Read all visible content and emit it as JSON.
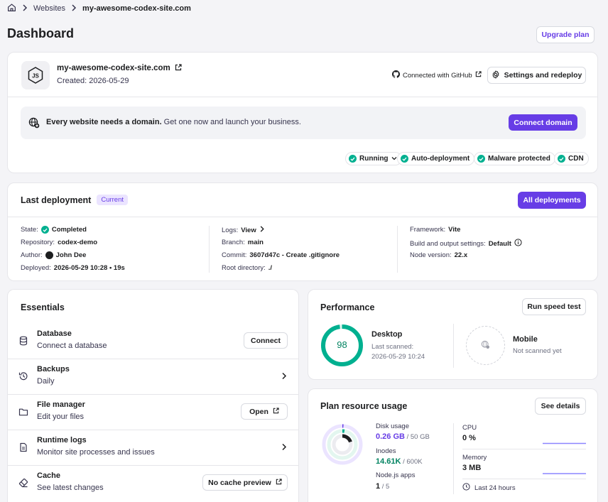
{
  "breadcrumb": {
    "home_icon": "home-icon",
    "item1": "Websites",
    "item2": "my-awesome-codex-site.com"
  },
  "page_title": "Dashboard",
  "upgrade_label": "Upgrade plan",
  "site": {
    "name": "my-awesome-codex-site.com",
    "created": "Created: 2026-05-29",
    "github": "Connected with GitHub",
    "settings_label": "Settings and redeploy",
    "logo_icon": "nodejs-icon"
  },
  "domain_banner": {
    "bold": "Every website needs a domain.",
    "text": " Get one now and launch your business.",
    "button": "Connect domain"
  },
  "status_pills": [
    "Running",
    "Auto-deployment",
    "Malware protected",
    "CDN"
  ],
  "deployment": {
    "title": "Last deployment",
    "badge": "Current",
    "button": "All deployments",
    "state_k": "State:",
    "state_v": "Completed",
    "repo_k": "Repository:",
    "repo_v": "codex-demo",
    "author_k": "Author:",
    "author_v": "John Dee",
    "deployed_k": "Deployed:",
    "deployed_v": "2026-05-29 10:28 • 19s",
    "logs_k": "Logs:",
    "logs_v": "View",
    "branch_k": "Branch:",
    "branch_v": "main",
    "commit_k": "Commit:",
    "commit_v": "3607d47c - Create .gitignore",
    "root_k": "Root directory:",
    "root_v": "./",
    "framework_k": "Framework:",
    "framework_v": "Vite",
    "build_k": "Build and output settings:",
    "build_v": "Default",
    "node_k": "Node version:",
    "node_v": "22.x"
  },
  "essentials": {
    "title": "Essentials",
    "items": [
      {
        "title": "Database",
        "sub": "Connect a database",
        "action": "Connect",
        "icon": "database-icon"
      },
      {
        "title": "Backups",
        "sub": "Daily",
        "icon": "history-icon"
      },
      {
        "title": "File manager",
        "sub": "Edit your files",
        "action": "Open",
        "icon": "folder-icon"
      },
      {
        "title": "Runtime logs",
        "sub": "Monitor site processes and issues",
        "icon": "document-icon"
      },
      {
        "title": "Cache",
        "sub": "See latest changes",
        "action": "No cache preview",
        "icon": "eraser-icon"
      }
    ]
  },
  "performance": {
    "title": "Performance",
    "button": "Run speed test",
    "desktop": {
      "label": "Desktop",
      "score": "98",
      "score_value": 98,
      "scanned_label": "Last scanned:",
      "scanned": "2026-05-29 10:24"
    },
    "mobile": {
      "label": "Mobile",
      "status": "Not scanned yet"
    }
  },
  "resources": {
    "title": "Plan resource usage",
    "button": "See details",
    "disk": {
      "label": "Disk usage",
      "value": "0.26 GB",
      "limit": " / 50 GB"
    },
    "inodes": {
      "label": "Inodes",
      "value": "14.61K",
      "limit": " / 600K"
    },
    "apps": {
      "label": "Node.js apps",
      "value": "1",
      "limit": " / 5"
    },
    "cpu": {
      "label": "CPU",
      "value": "0 %"
    },
    "memory": {
      "label": "Memory",
      "value": "3 MB"
    },
    "period": "Last 24 hours"
  },
  "colors": {
    "primary": "#673de6",
    "success": "#00b090",
    "green_text": "#008361"
  }
}
